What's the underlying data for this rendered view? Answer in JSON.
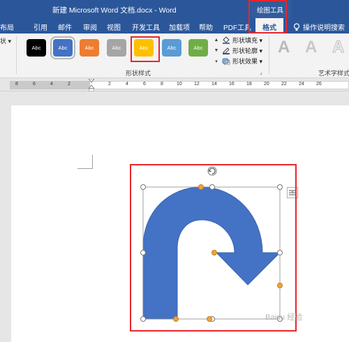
{
  "titlebar": {
    "title": "新建 Microsoft Word 文档.docx  -  Word",
    "context_group": "绘图工具"
  },
  "tabs": [
    {
      "label": "布局"
    },
    {
      "label": "引用"
    },
    {
      "label": "邮件"
    },
    {
      "label": "审阅"
    },
    {
      "label": "视图"
    },
    {
      "label": "开发工具"
    },
    {
      "label": "加载项"
    },
    {
      "label": "帮助"
    },
    {
      "label": "PDF工具"
    },
    {
      "label": "格式",
      "active": true
    }
  ],
  "tell_me": "操作说明搜索",
  "ribbon": {
    "left_stub": "状 ▾",
    "shape_styles": [
      {
        "label": "Abc",
        "color": "#000000"
      },
      {
        "label": "Abc",
        "color": "#4472c4",
        "selected": true
      },
      {
        "label": "Abc",
        "color": "#ed7d31"
      },
      {
        "label": "Abc",
        "color": "#a5a5a5"
      },
      {
        "label": "Abc",
        "color": "#ffc000",
        "highlighted": true
      },
      {
        "label": "Abc",
        "color": "#5b9bd5"
      },
      {
        "label": "Abc",
        "color": "#70ad47"
      }
    ],
    "shape_styles_label": "形状样式",
    "shape_fill": "形状填充 ▾",
    "shape_outline": "形状轮廓 ▾",
    "shape_effects": "形状效果 ▾",
    "wordart_label": "艺术字样式",
    "wordart_letters": [
      "A",
      "A",
      "A"
    ]
  },
  "ruler": {
    "numbers": [
      "8",
      "6",
      "4",
      "2",
      "2",
      "4",
      "6",
      "8",
      "10",
      "12",
      "14",
      "16",
      "18",
      "20",
      "22",
      "24",
      "26"
    ]
  },
  "shape": {
    "name": "U-turn arrow",
    "fill": "#4472c4",
    "selected": true
  },
  "watermark": "Baidu 经验"
}
